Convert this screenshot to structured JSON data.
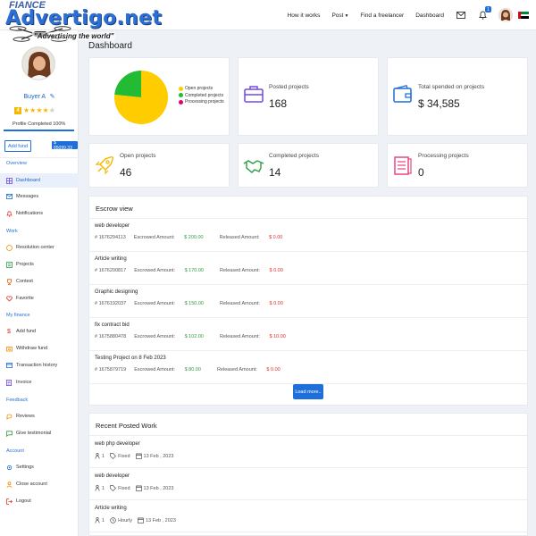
{
  "logo": {
    "name": "Advertigo.net",
    "tagline": "\"Advertising the world\"",
    "overlay": "FIANCE"
  },
  "topnav": {
    "how_it_works": "How it works",
    "post": "Post",
    "find_freelancer": "Find a freelancer",
    "dashboard": "Dashboard",
    "notification_count": "1"
  },
  "profile": {
    "name": "Buyer A",
    "rating": "4",
    "stars": 4,
    "profile_complete_label": "Profile Completed",
    "profile_complete_value": "100%",
    "profile_complete_fraction": 1.0,
    "add_fund": "Add fund",
    "balance": "$ 85099.33"
  },
  "sidebar": {
    "overview": "Overview",
    "dashboard": "Dashboard",
    "messages": "Messages",
    "notifications": "Notifications",
    "work": "Work",
    "resolution_center": "Resolution center",
    "projects": "Projects",
    "contest": "Contest",
    "favorite": "Favorite",
    "my_finance": "My finance",
    "add_fund": "Add fund",
    "withdraw_fund": "Withdraw fund",
    "transaction_history": "Transaction history",
    "invoice": "Invoice",
    "feedback": "Feedback",
    "reviews": "Reviews",
    "give_testimonial": "Give testimonial",
    "account": "Account",
    "settings": "Settings",
    "close_account": "Close account",
    "logout": "Logout"
  },
  "page": {
    "title": "Dashboard"
  },
  "chart_data": {
    "type": "pie",
    "categories": [
      "Open projects",
      "Completed projects",
      "Processing projects"
    ],
    "values": [
      46,
      14,
      0
    ],
    "colors": [
      "#ffcc00",
      "#22bb33",
      "#e6006e"
    ],
    "legend": "right"
  },
  "stats": {
    "posted_label": "Posted projects",
    "posted_value": "168",
    "spent_label": "Total spended on projects",
    "spent_value": "$ 34,585",
    "open_label": "Open projects",
    "open_value": "46",
    "completed_label": "Completed projects",
    "completed_value": "14",
    "processing_label": "Processing projects",
    "processing_value": "0"
  },
  "escrow": {
    "title": "Escrow view",
    "escrowed_label": "Escrowed Amount:",
    "released_label": "Released Amount:",
    "items": [
      {
        "title": "web developer",
        "id": "# 1676294113",
        "escrowed": "$ 200.00",
        "released": "$ 0.00"
      },
      {
        "title": "Article writing",
        "id": "# 1676200817",
        "escrowed": "$ 170.00",
        "released": "$ 0.00"
      },
      {
        "title": "Graphic designing",
        "id": "# 1676192037",
        "escrowed": "$ 150.00",
        "released": "$ 0.00"
      },
      {
        "title": "fix contract bid",
        "id": "# 1675880478",
        "escrowed": "$ 102.00",
        "released": "$ 10.00"
      },
      {
        "title": "Testing Project on 8 Feb 2023",
        "id": "# 1675879719",
        "escrowed": "$ 80.00",
        "released": "$ 0.00"
      }
    ],
    "load_more": "Load more.."
  },
  "recent": {
    "title": "Recent Posted Work",
    "items": [
      {
        "title": "web php developer",
        "count": "1",
        "type": "Fixed",
        "date": "13 Feb , 2023"
      },
      {
        "title": "web developer",
        "count": "1",
        "type": "Fixed",
        "date": "13 Feb , 2023"
      },
      {
        "title": "Article writing",
        "count": "1",
        "type": "Hourly",
        "date": "13 Feb , 2023"
      }
    ]
  }
}
